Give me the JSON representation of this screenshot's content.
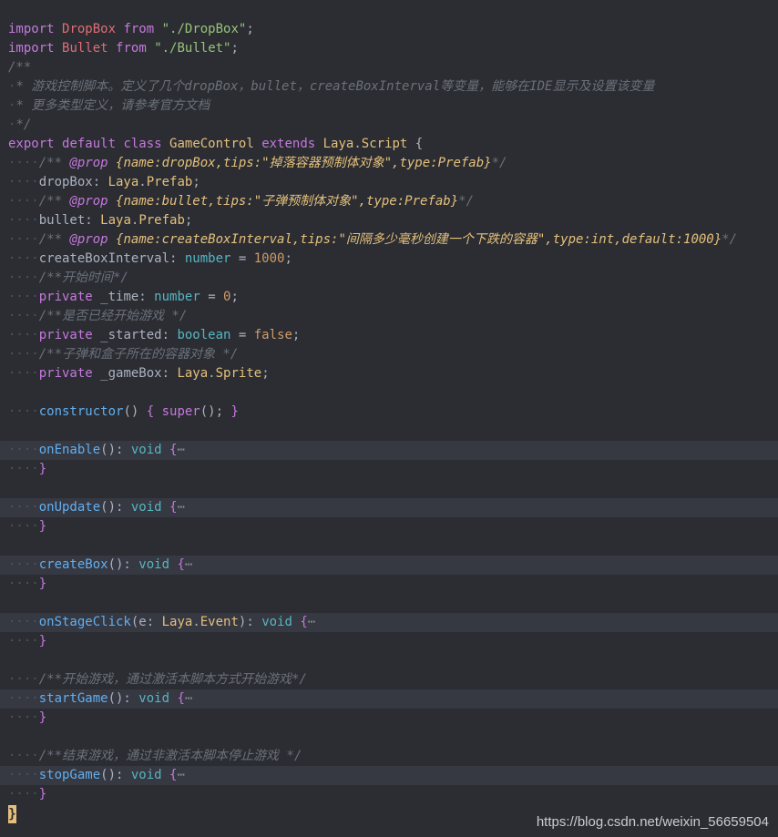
{
  "colors": {
    "background": "#2b2d33",
    "keyword": "#c678dd",
    "class_name": "#e5c07b",
    "string": "#98c379",
    "comment": "#6b7079",
    "function": "#61afef",
    "type": "#56b6c2",
    "number": "#d19a66"
  },
  "watermark": "https://blog.csdn.net/weixin_56659504",
  "lines": [
    {
      "folded": false,
      "tokens": [
        [
          "kw",
          "import "
        ],
        [
          "var",
          "DropBox "
        ],
        [
          "kw",
          "from "
        ],
        [
          "str",
          "\"./DropBox\""
        ],
        [
          "punc",
          ";"
        ]
      ]
    },
    {
      "folded": false,
      "tokens": [
        [
          "kw",
          "import "
        ],
        [
          "var",
          "Bullet "
        ],
        [
          "kw",
          "from "
        ],
        [
          "str",
          "\"./Bullet\""
        ],
        [
          "punc",
          ";"
        ]
      ]
    },
    {
      "folded": false,
      "tokens": [
        [
          "cmt",
          "/**"
        ]
      ]
    },
    {
      "folded": false,
      "tokens": [
        [
          "ws",
          "·"
        ],
        [
          "cmt",
          "* 游戏控制脚本。定义了几个dropBox，bullet，createBoxInterval等变量，能够在IDE显示及设置该变量"
        ]
      ]
    },
    {
      "folded": false,
      "tokens": [
        [
          "ws",
          "·"
        ],
        [
          "cmt",
          "* 更多类型定义，请参考官方文档"
        ]
      ]
    },
    {
      "folded": false,
      "tokens": [
        [
          "ws",
          "·"
        ],
        [
          "cmt",
          "*/"
        ]
      ]
    },
    {
      "folded": false,
      "tokens": [
        [
          "kw",
          "export "
        ],
        [
          "kw",
          "default "
        ],
        [
          "kw",
          "class "
        ],
        [
          "cls",
          "GameControl "
        ],
        [
          "kw",
          "extends "
        ],
        [
          "cls",
          "Laya"
        ],
        [
          "punc",
          "."
        ],
        [
          "cls",
          "Script "
        ],
        [
          "punc",
          "{"
        ]
      ]
    },
    {
      "folded": false,
      "tokens": [
        [
          "ws",
          "····"
        ],
        [
          "cmt",
          "/** "
        ],
        [
          "tag",
          "@prop "
        ],
        [
          "tagc",
          "{name:dropBox,tips:\"掉落容器预制体对象\",type:Prefab}"
        ],
        [
          "cmt",
          "*/"
        ]
      ]
    },
    {
      "folded": false,
      "tokens": [
        [
          "ws",
          "····"
        ],
        [
          "punc",
          "dropBox: "
        ],
        [
          "cls",
          "Laya"
        ],
        [
          "punc",
          "."
        ],
        [
          "cls",
          "Prefab"
        ],
        [
          "punc",
          ";"
        ]
      ]
    },
    {
      "folded": false,
      "tokens": [
        [
          "ws",
          "····"
        ],
        [
          "cmt",
          "/** "
        ],
        [
          "tag",
          "@prop "
        ],
        [
          "tagc",
          "{name:bullet,tips:\"子弹预制体对象\",type:Prefab}"
        ],
        [
          "cmt",
          "*/"
        ]
      ]
    },
    {
      "folded": false,
      "tokens": [
        [
          "ws",
          "····"
        ],
        [
          "punc",
          "bullet: "
        ],
        [
          "cls",
          "Laya"
        ],
        [
          "punc",
          "."
        ],
        [
          "cls",
          "Prefab"
        ],
        [
          "punc",
          ";"
        ]
      ]
    },
    {
      "folded": false,
      "tokens": [
        [
          "ws",
          "····"
        ],
        [
          "cmt",
          "/** "
        ],
        [
          "tag",
          "@prop "
        ],
        [
          "tagc",
          "{name:createBoxInterval,tips:\"间隔多少毫秒创建一个下跌的容器\",type:int,default:1000}"
        ],
        [
          "cmt",
          "*/"
        ]
      ]
    },
    {
      "folded": false,
      "tokens": [
        [
          "ws",
          "····"
        ],
        [
          "punc",
          "createBoxInterval: "
        ],
        [
          "typ",
          "number "
        ],
        [
          "punc",
          "= "
        ],
        [
          "num",
          "1000"
        ],
        [
          "punc",
          ";"
        ]
      ]
    },
    {
      "folded": false,
      "tokens": [
        [
          "ws",
          "····"
        ],
        [
          "cmt",
          "/**开始时间*/"
        ]
      ]
    },
    {
      "folded": false,
      "tokens": [
        [
          "ws",
          "····"
        ],
        [
          "kw",
          "private "
        ],
        [
          "punc",
          "_time: "
        ],
        [
          "typ",
          "number "
        ],
        [
          "punc",
          "= "
        ],
        [
          "num",
          "0"
        ],
        [
          "punc",
          ";"
        ]
      ]
    },
    {
      "folded": false,
      "tokens": [
        [
          "ws",
          "····"
        ],
        [
          "cmt",
          "/**是否已经开始游戏 */"
        ]
      ]
    },
    {
      "folded": false,
      "tokens": [
        [
          "ws",
          "····"
        ],
        [
          "kw",
          "private "
        ],
        [
          "punc",
          "_started: "
        ],
        [
          "typ",
          "boolean "
        ],
        [
          "punc",
          "= "
        ],
        [
          "num",
          "false"
        ],
        [
          "punc",
          ";"
        ]
      ]
    },
    {
      "folded": false,
      "tokens": [
        [
          "ws",
          "····"
        ],
        [
          "cmt",
          "/**子弹和盒子所在的容器对象 */"
        ]
      ]
    },
    {
      "folded": false,
      "tokens": [
        [
          "ws",
          "····"
        ],
        [
          "kw",
          "private "
        ],
        [
          "punc",
          "_gameBox: "
        ],
        [
          "cls",
          "Laya"
        ],
        [
          "punc",
          "."
        ],
        [
          "cls",
          "Sprite"
        ],
        [
          "punc",
          ";"
        ]
      ]
    },
    {
      "folded": false,
      "tokens": []
    },
    {
      "folded": false,
      "tokens": [
        [
          "ws",
          "····"
        ],
        [
          "fn",
          "constructor"
        ],
        [
          "punc",
          "() "
        ],
        [
          "kw",
          "{ "
        ],
        [
          "kw",
          "super"
        ],
        [
          "punc",
          "(); "
        ],
        [
          "kw",
          "}"
        ]
      ]
    },
    {
      "folded": false,
      "tokens": []
    },
    {
      "folded": true,
      "tokens": [
        [
          "ws",
          "····"
        ],
        [
          "fn",
          "onEnable"
        ],
        [
          "punc",
          "(): "
        ],
        [
          "typ",
          "void "
        ],
        [
          "kw",
          "{"
        ],
        [
          "ellip",
          "⋯"
        ]
      ]
    },
    {
      "folded": false,
      "tokens": [
        [
          "ws",
          "····"
        ],
        [
          "kw",
          "}"
        ]
      ]
    },
    {
      "folded": false,
      "tokens": []
    },
    {
      "folded": true,
      "tokens": [
        [
          "ws",
          "····"
        ],
        [
          "fn",
          "onUpdate"
        ],
        [
          "punc",
          "(): "
        ],
        [
          "typ",
          "void "
        ],
        [
          "kw",
          "{"
        ],
        [
          "ellip",
          "⋯"
        ]
      ]
    },
    {
      "folded": false,
      "tokens": [
        [
          "ws",
          "····"
        ],
        [
          "kw",
          "}"
        ]
      ]
    },
    {
      "folded": false,
      "tokens": []
    },
    {
      "folded": true,
      "tokens": [
        [
          "ws",
          "····"
        ],
        [
          "fn",
          "createBox"
        ],
        [
          "punc",
          "(): "
        ],
        [
          "typ",
          "void "
        ],
        [
          "kw",
          "{"
        ],
        [
          "ellip",
          "⋯"
        ]
      ]
    },
    {
      "folded": false,
      "tokens": [
        [
          "ws",
          "····"
        ],
        [
          "kw",
          "}"
        ]
      ]
    },
    {
      "folded": false,
      "tokens": []
    },
    {
      "folded": true,
      "tokens": [
        [
          "ws",
          "····"
        ],
        [
          "fn",
          "onStageClick"
        ],
        [
          "punc",
          "(e: "
        ],
        [
          "cls",
          "Laya"
        ],
        [
          "punc",
          "."
        ],
        [
          "cls",
          "Event"
        ],
        [
          "punc",
          "): "
        ],
        [
          "typ",
          "void "
        ],
        [
          "kw",
          "{"
        ],
        [
          "ellip",
          "⋯"
        ]
      ]
    },
    {
      "folded": false,
      "tokens": [
        [
          "ws",
          "····"
        ],
        [
          "kw",
          "}"
        ]
      ]
    },
    {
      "folded": false,
      "tokens": []
    },
    {
      "folded": false,
      "tokens": [
        [
          "ws",
          "····"
        ],
        [
          "cmt",
          "/**开始游戏，通过激活本脚本方式开始游戏*/"
        ]
      ]
    },
    {
      "folded": true,
      "tokens": [
        [
          "ws",
          "····"
        ],
        [
          "fn",
          "startGame"
        ],
        [
          "punc",
          "(): "
        ],
        [
          "typ",
          "void "
        ],
        [
          "kw",
          "{"
        ],
        [
          "ellip",
          "⋯"
        ]
      ]
    },
    {
      "folded": false,
      "tokens": [
        [
          "ws",
          "····"
        ],
        [
          "kw",
          "}"
        ]
      ]
    },
    {
      "folded": false,
      "tokens": []
    },
    {
      "folded": false,
      "tokens": [
        [
          "ws",
          "····"
        ],
        [
          "cmt",
          "/**结束游戏，通过非激活本脚本停止游戏 */"
        ]
      ]
    },
    {
      "folded": true,
      "tokens": [
        [
          "ws",
          "····"
        ],
        [
          "fn",
          "stopGame"
        ],
        [
          "punc",
          "(): "
        ],
        [
          "typ",
          "void "
        ],
        [
          "kw",
          "{"
        ],
        [
          "ellip",
          "⋯"
        ]
      ]
    },
    {
      "folded": false,
      "tokens": [
        [
          "ws",
          "····"
        ],
        [
          "kw",
          "}"
        ]
      ]
    }
  ],
  "closing_brace": "}"
}
